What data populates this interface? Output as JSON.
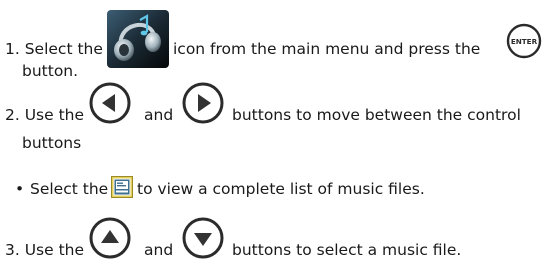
{
  "step1": {
    "prefix": "1. Select the",
    "middle": "icon from the main menu and press the",
    "continuation": "button.",
    "enter_icon_label": "ENTER",
    "music_icon": "music-headphones-icon"
  },
  "step2": {
    "prefix": "2. Use the",
    "and": "and",
    "suffix": "buttons to move between the control",
    "continuation": "buttons"
  },
  "bullet": {
    "marker": "•",
    "prefix": "Select the",
    "suffix": "to view a complete list of music files.",
    "icon": "playlist-icon"
  },
  "step3": {
    "prefix": "3. Use the",
    "and": "and",
    "suffix": "buttons to select a music file."
  },
  "colors": {
    "button_ring": "#2b2b2b",
    "button_arrow": "#333333",
    "playlist_frame": "#d9c24a"
  }
}
